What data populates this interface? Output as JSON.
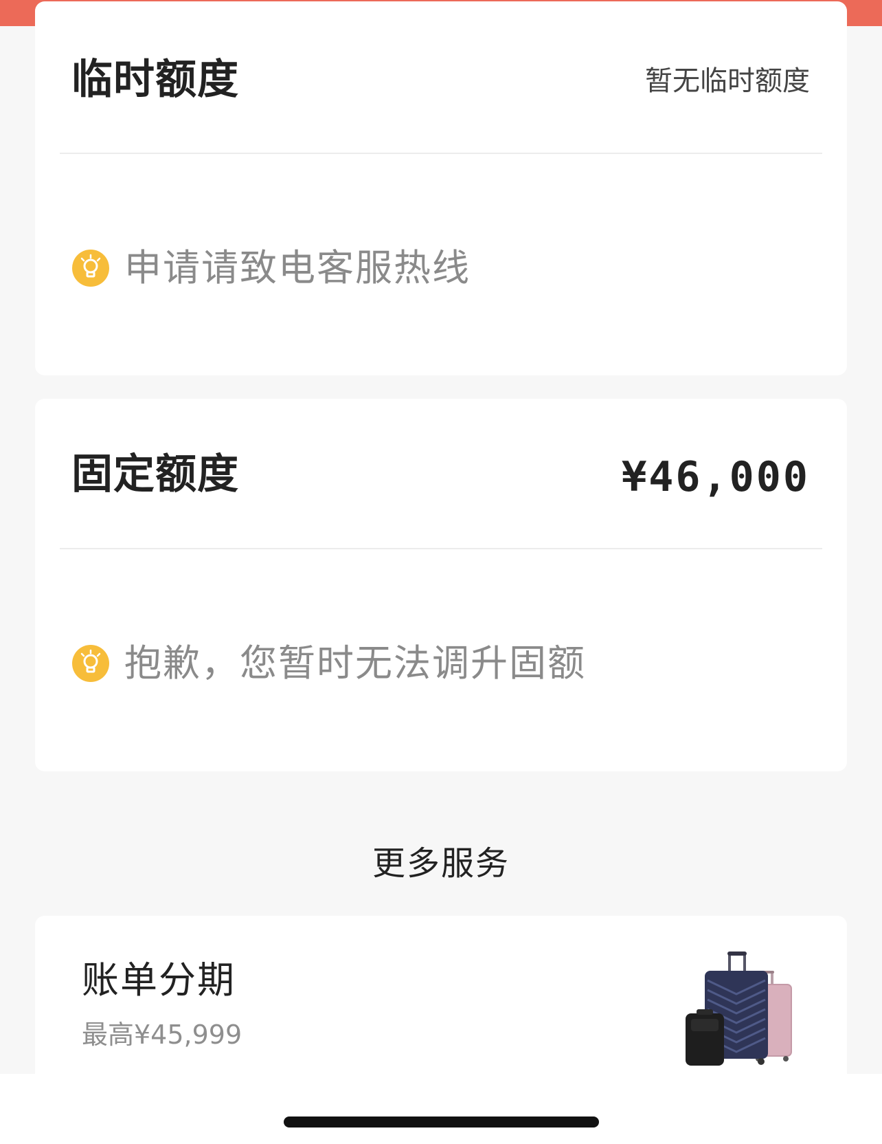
{
  "temp_limit": {
    "title": "临时额度",
    "value": "暂无临时额度",
    "tip": "申请请致电客服热线",
    "tip_icon": "lightbulb-icon"
  },
  "fixed_limit": {
    "title": "固定额度",
    "amount": "¥46,000",
    "tip": "抱歉，您暂时无法调升固额",
    "tip_icon": "lightbulb-icon"
  },
  "more_services": {
    "title": "更多服务",
    "items": [
      {
        "title": "账单分期",
        "subtitle": "最高¥45,999",
        "image": "luggage-image"
      }
    ]
  },
  "colors": {
    "accent": "#ec6a58",
    "tip_icon": "#f7bd3a"
  }
}
